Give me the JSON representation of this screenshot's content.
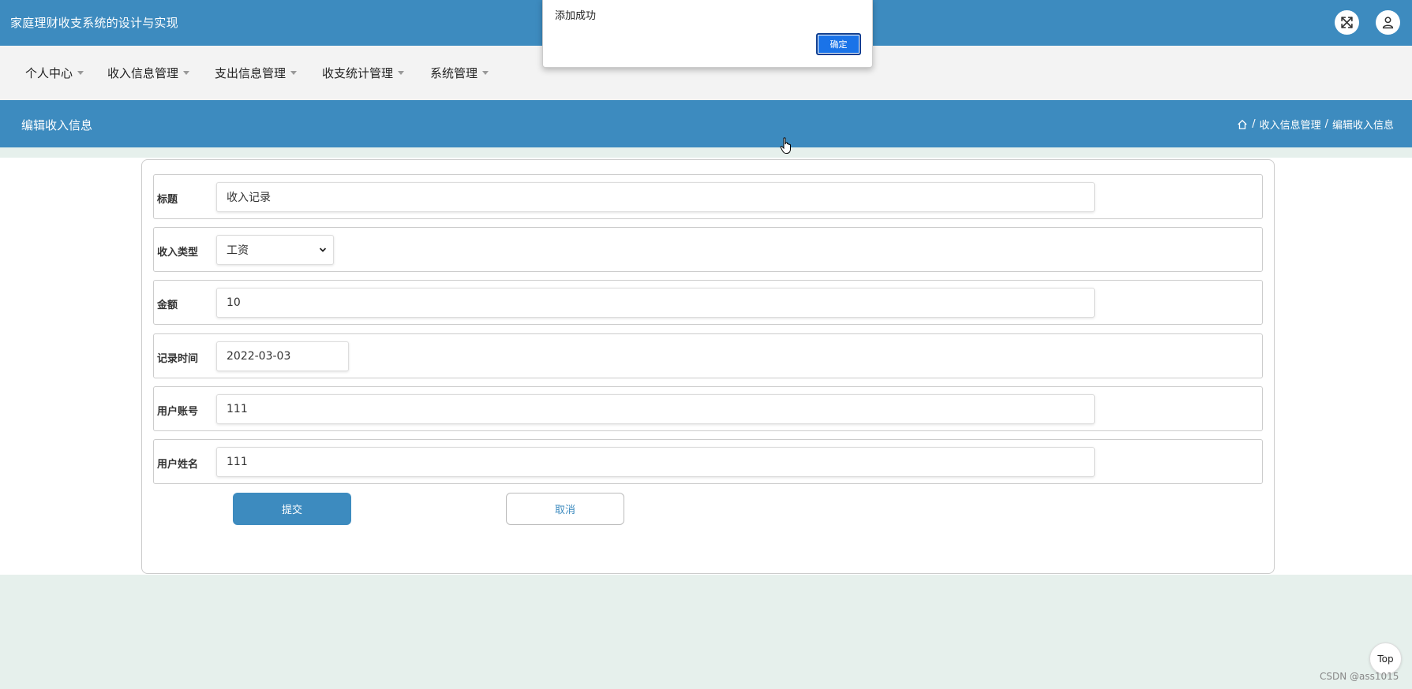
{
  "app": {
    "title": "家庭理财收支系统的设计与实现"
  },
  "topbar": {
    "fullscreen_icon": "fullscreen-icon",
    "user_icon": "user-icon"
  },
  "nav": {
    "items": [
      {
        "label": "个人中心"
      },
      {
        "label": "收入信息管理"
      },
      {
        "label": "支出信息管理"
      },
      {
        "label": "收支统计管理"
      },
      {
        "label": "系统管理"
      }
    ]
  },
  "header": {
    "page_title": "编辑收入信息",
    "breadcrumb": {
      "home_icon": "home-icon",
      "separator": "/",
      "level1": "收入信息管理",
      "level2": "编辑收入信息"
    }
  },
  "form": {
    "title_label": "标题",
    "title_value": "收入记录",
    "type_label": "收入类型",
    "type_value": "工资",
    "amount_label": "金额",
    "amount_value": "10",
    "date_label": "记录时间",
    "date_value": "2022-03-03",
    "account_label": "用户账号",
    "account_value": "111",
    "name_label": "用户姓名",
    "name_value": "111",
    "submit_label": "提交",
    "cancel_label": "取消"
  },
  "dialog": {
    "message": "添加成功",
    "ok_label": "确定"
  },
  "scroll_top": {
    "label": "Top"
  },
  "watermark": "CSDN @ass1015",
  "colors": {
    "primary": "#3d8bbf",
    "nav_bg": "#f3f3f3",
    "page_bg": "#e6f0ec",
    "dialog_button": "#1a73e8"
  }
}
